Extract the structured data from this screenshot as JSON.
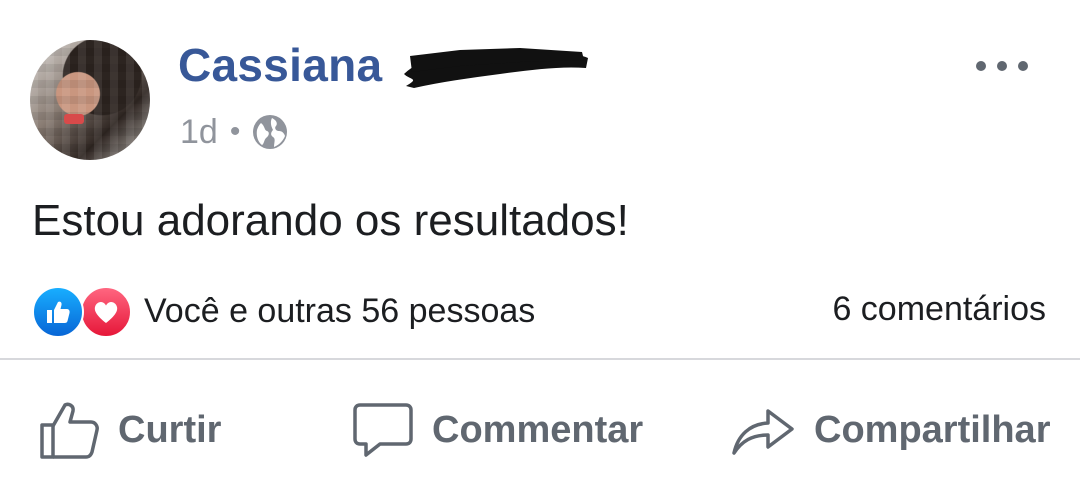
{
  "post": {
    "author": "Cassiana",
    "time": "1d",
    "separator": "•",
    "privacy_icon": "globe-icon",
    "text": "Estou adorando os resultados!",
    "more_icon": "more-options-icon"
  },
  "reactions": {
    "icons": [
      "like-reaction-icon",
      "love-reaction-icon"
    ],
    "summary": "Você e outras 56 pessoas",
    "comments": "6 comentários"
  },
  "actions": {
    "like_label": "Curtir",
    "comment_label": "Commentar",
    "share_label": "Compartilhar"
  },
  "colors": {
    "author_name": "#385898",
    "meta_gray": "#90949c",
    "action_gray": "#606770",
    "text": "#1c1e21",
    "like_blue": "#0866d6",
    "love_red": "#e61739",
    "divider": "#d7d8dc"
  }
}
